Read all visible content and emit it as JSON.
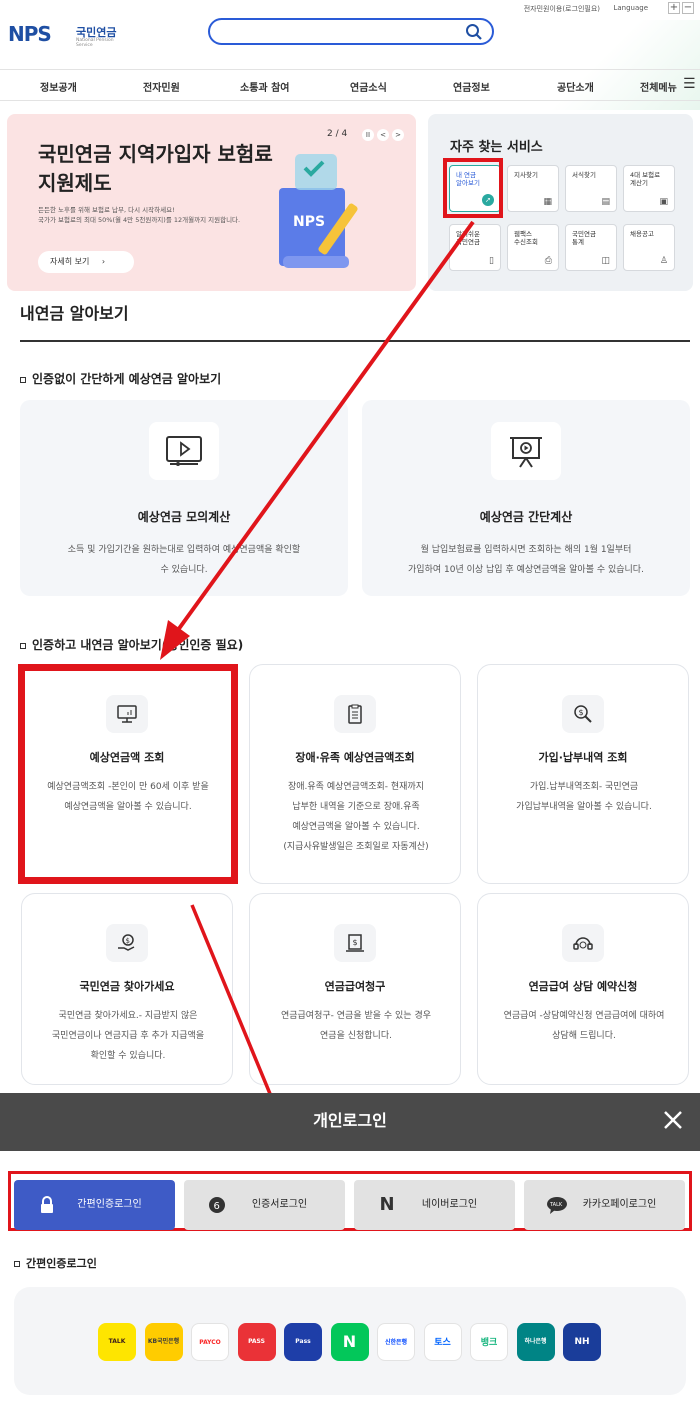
{
  "topbar": {
    "util": "전자민원이용(로그인필요)",
    "language": "Language",
    "zoom_in": "+",
    "zoom_out": "−"
  },
  "logo": {
    "mark": "NPS",
    "kr": "국민연금",
    "en": "National Pension Service"
  },
  "gnb": [
    "정보공개",
    "전자민원",
    "소통과 참여",
    "연금소식",
    "연금정보",
    "공단소개",
    "전체메뉴"
  ],
  "banner": {
    "page": "2 / 4",
    "title": "국민연금 지역가입자 보험료 지원제도",
    "desc_1": "든든한 노후를 위해 보험료 납부, 다시 시작하세요!",
    "desc_2": "국가가 보험료의 최대 50%(월 4만 5천원까지)를 12개월까지 지원합니다.",
    "more": "자세히 보기",
    "pause": "II",
    "prev": "<",
    "next": ">",
    "image_text": "NPS"
  },
  "freq": {
    "title": "자주 찾는 서비스",
    "tiles": [
      {
        "l1": "내 연금",
        "l2": "알아보기"
      },
      {
        "l1": "지사찾기",
        "l2": ""
      },
      {
        "l1": "서식찾기",
        "l2": ""
      },
      {
        "l1": "4대 보험료",
        "l2": "계산기"
      },
      {
        "l1": "알기쉬운",
        "l2": "국민연금"
      },
      {
        "l1": "웹팩스",
        "l2": "수신조회"
      },
      {
        "l1": "국민연금",
        "l2": "통계"
      },
      {
        "l1": "채용공고",
        "l2": ""
      }
    ]
  },
  "section": {
    "title": "내연금 알아보기",
    "sub1": "인증없이 간단하게 예상연금 알아보기",
    "sub2": "인증하고 내연금 알아보기(공인인증 필요)"
  },
  "bigcards": [
    {
      "title": "예상연금 모의계산",
      "d1": "소득 및 가입기간을 원하는대로 입력하여 예상연금액을 확인할",
      "d2": "수 있습니다."
    },
    {
      "title": "예상연금 간단계산",
      "d1": "월 납입보험료를 입력하시면 조회하는 해의 1월 1일부터",
      "d2": "가입하여 10년 이상 납입 후 예상연금액을 알아볼 수 있습니다."
    }
  ],
  "cards": [
    {
      "title": "예상연금액 조회",
      "lines": [
        "예상연금액조회 -본인이 만 60세 이후 받을",
        "예상연금액을 알아볼 수 있습니다.",
        "",
        ""
      ]
    },
    {
      "title": "장애·유족 예상연금액조회",
      "lines": [
        "장애.유족 예상연금액조회- 현재까지",
        "납부한 내역을 기준으로 장애.유족",
        "예상연금액을 알아볼 수 있습니다.",
        "(지급사유발생일은 조회일로 자동계산)"
      ]
    },
    {
      "title": "가입·납부내역 조회",
      "lines": [
        "가입.납부내역조회- 국민연금",
        "가입납부내역을 알아볼 수 있습니다.",
        "",
        ""
      ]
    },
    {
      "title": "국민연금 찾아가세요",
      "lines": [
        "국민연금 찾아가세요.- 지급받지 않은",
        "국민연금이나 연금지급 후 추가 지급액을",
        "확인할 수 있습니다.",
        ""
      ]
    },
    {
      "title": "연금급여청구",
      "lines": [
        "연금급여청구- 연금을 받을 수 있는 경우",
        "연금을 신청합니다.",
        "",
        ""
      ]
    },
    {
      "title": "연금급여 상담 예약신청",
      "lines": [
        "연금급여 -상담예약신청 연금급여에 대하여",
        "상담해 드립니다.",
        "",
        ""
      ]
    }
  ],
  "modal": {
    "title": "개인로그인",
    "close": "×"
  },
  "tabs": [
    {
      "label": "간편인증로그인"
    },
    {
      "label": "인증서로그인"
    },
    {
      "label": "네이버로그인"
    },
    {
      "label": "카카오페이로그인"
    }
  ],
  "login_section": "간편인증로그인",
  "apps": [
    {
      "name": "TALK",
      "bg": "#fee500",
      "fg": "#3a1d1d"
    },
    {
      "name": "KB국민은행",
      "bg": "#ffcc00",
      "fg": "#3b3b3b"
    },
    {
      "name": "PAYCO",
      "bg": "#ffffff",
      "fg": "#fa2828"
    },
    {
      "name": "PASS",
      "bg": "#ea3237",
      "fg": "#ffffff"
    },
    {
      "name": "Pass",
      "bg": "#1e3ea8",
      "fg": "#ffffff"
    },
    {
      "name": "N",
      "bg": "#03c75a",
      "fg": "#ffffff"
    },
    {
      "name": "신한은행",
      "bg": "#ffffff",
      "fg": "#0046ff"
    },
    {
      "name": "토스",
      "bg": "#ffffff",
      "fg": "#0064ff"
    },
    {
      "name": "뱅크",
      "bg": "#ffffff",
      "fg": "#18b67f"
    },
    {
      "name": "하나은행",
      "bg": "#008485",
      "fg": "#ffffff"
    },
    {
      "name": "NH",
      "bg": "#1a3d9a",
      "fg": "#ffffff"
    }
  ]
}
